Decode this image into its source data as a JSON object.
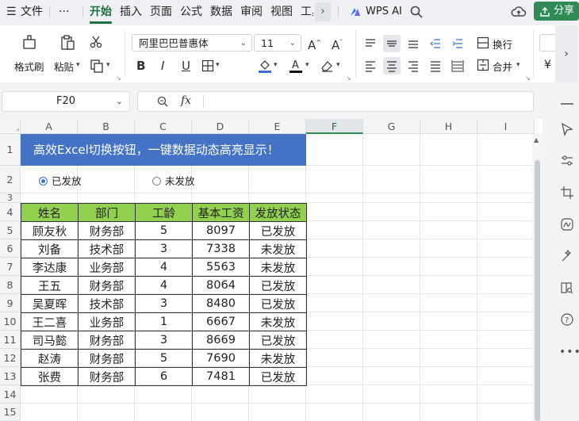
{
  "menubar": {
    "hamburger": "☰",
    "file": "文件",
    "more": "···",
    "tabs": [
      "开始",
      "插入",
      "页面",
      "公式",
      "数据",
      "审阅",
      "视图",
      "工具"
    ],
    "wps_ai": "WPS AI",
    "share": "分享"
  },
  "ribbon": {
    "format_painter": "格式刷",
    "paste": "粘贴",
    "font_name": "阿里巴巴普惠体",
    "font_size": "11",
    "font_grow": "A",
    "font_shrink": "A",
    "bold": "B",
    "italic": "I",
    "underline": "U",
    "wrap_text": "换行",
    "merge": "合并",
    "partial_right": "¥"
  },
  "formula_bar": {
    "cell_ref": "F20",
    "fx": "fx",
    "content": ""
  },
  "sheet": {
    "columns": [
      "A",
      "B",
      "C",
      "D",
      "E",
      "F",
      "G",
      "H",
      "I"
    ],
    "selected_column": "F",
    "rows": [
      "1",
      "2",
      "3",
      "4",
      "5",
      "6",
      "7",
      "8",
      "9",
      "10",
      "11",
      "12",
      "13",
      "14",
      "15"
    ],
    "title": "高效Excel切换按钮，一键数据动态高亮显示！",
    "radio_issued": "已发放",
    "radio_not_issued": "未发放",
    "radio_selected": "已发放",
    "table": {
      "headers": [
        "姓名",
        "部门",
        "工龄",
        "基本工资",
        "发放状态"
      ],
      "rows": [
        [
          "顾友秋",
          "财务部",
          "5",
          "8097",
          "已发放"
        ],
        [
          "刘备",
          "技术部",
          "3",
          "7338",
          "未发放"
        ],
        [
          "李达康",
          "业务部",
          "4",
          "5563",
          "未发放"
        ],
        [
          "王五",
          "财务部",
          "4",
          "8064",
          "已发放"
        ],
        [
          "吴夏晖",
          "技术部",
          "3",
          "8480",
          "已发放"
        ],
        [
          "王二喜",
          "业务部",
          "1",
          "6667",
          "未发放"
        ],
        [
          "司马懿",
          "财务部",
          "3",
          "8669",
          "已发放"
        ],
        [
          "赵涛",
          "财务部",
          "5",
          "7690",
          "未发放"
        ],
        [
          "张费",
          "财务部",
          "6",
          "7481",
          "已发放"
        ]
      ]
    }
  },
  "colors": {
    "accent_green": "#1f6f3f",
    "share_button": "#2f8a56",
    "title_banner": "#4472c4",
    "table_header": "#92d050",
    "radio_selected": "#3b6fd8"
  }
}
